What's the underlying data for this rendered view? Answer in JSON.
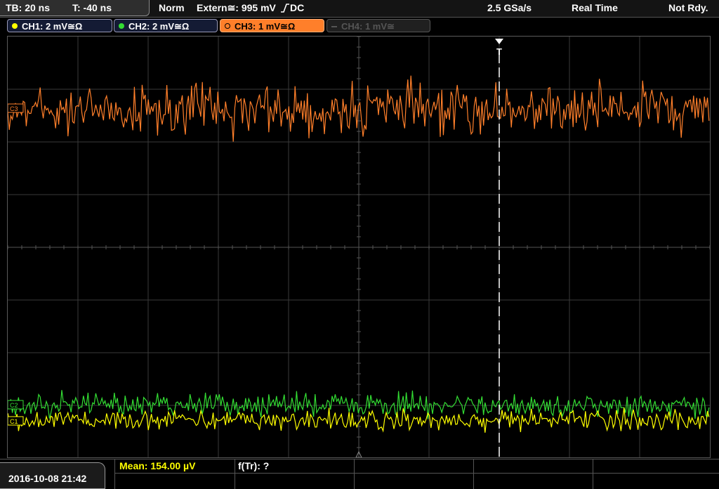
{
  "topbar": {
    "timebase": "TB: 20 ns",
    "trigger_time": "T: -40 ns",
    "mode": "Norm",
    "trigger_source": "Extern≅: 995 mV",
    "trigger_coupling": "DC",
    "sample_rate": "2.5 GSa/s",
    "acq_mode": "Real Time",
    "status": "Not Rdy."
  },
  "channels": [
    {
      "label": "CH1: 2 mV≅Ω",
      "color": "#ffff00",
      "state": "on"
    },
    {
      "label": "CH2: 2 mV≅Ω",
      "color": "#33dd33",
      "state": "on"
    },
    {
      "label": "CH3: 1 mV≅Ω",
      "color": "#ff7f2a",
      "state": "active"
    },
    {
      "label": "CH4: 1 mV≅",
      "color": "#555555",
      "state": "off"
    }
  ],
  "markers": {
    "ch3": "C3",
    "ch2": "C2",
    "ch1": "C1",
    "trigger": "T"
  },
  "colors": {
    "ch1": "#ffff00",
    "ch2": "#33dd33",
    "ch3": "#ff7f2a",
    "grid": "#3a3a3a"
  },
  "bottombar": {
    "datetime": "2016-10-08 21:42",
    "measurement_1": "Mean: 154.00 µV",
    "measurement_2": "f(Tr): ?"
  }
}
